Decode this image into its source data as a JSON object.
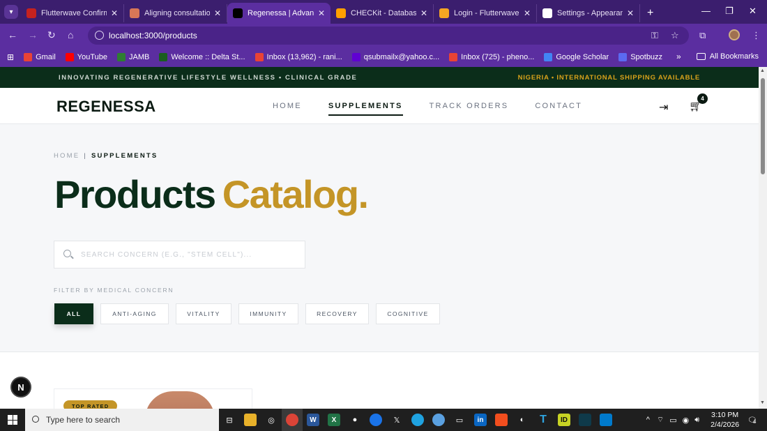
{
  "browser": {
    "tabs": [
      {
        "title": "Flutterwave Confirma",
        "icon": "gmail-icon",
        "color": "#c5221f",
        "active": false
      },
      {
        "title": "Aligning consultation",
        "icon": "claude-icon",
        "color": "#d97757",
        "active": false
      },
      {
        "title": "Regenessa | Advance",
        "icon": "vercel-icon",
        "color": "#000000",
        "active": true
      },
      {
        "title": "CHECKit - Database",
        "icon": "firebase-icon",
        "color": "#ffa000",
        "active": false
      },
      {
        "title": "Login - Flutterwave",
        "icon": "flutterwave-icon",
        "color": "#f5a623",
        "active": false
      },
      {
        "title": "Settings - Appearanc",
        "icon": "gear-icon",
        "color": "#ffffff",
        "active": false
      }
    ],
    "url": "localhost:3000/products",
    "bookmarks": [
      {
        "label": "Gmail",
        "color": "#ea4335"
      },
      {
        "label": "YouTube",
        "color": "#ff0000"
      },
      {
        "label": "JAMB",
        "color": "#2e7d32"
      },
      {
        "label": "Welcome :: Delta St...",
        "color": "#1b5e20"
      },
      {
        "label": "Inbox (13,962) - rani...",
        "color": "#ea4335"
      },
      {
        "label": "qsubmailx@yahoo.c...",
        "color": "#6001d2"
      },
      {
        "label": "Inbox (725) - pheno...",
        "color": "#ea4335"
      },
      {
        "label": "Google Scholar",
        "color": "#4285f4"
      },
      {
        "label": "Spotbuzz",
        "color": "#5b6af0"
      }
    ],
    "all_bookmarks": "All Bookmarks"
  },
  "site": {
    "promo_left": "INNOVATING REGENERATIVE LIFESTYLE WELLNESS • CLINICAL GRADE",
    "promo_right": "NIGERIA • INTERNATIONAL SHIPPING AVAILABLE",
    "logo": "REGENESSA",
    "nav": [
      "HOME",
      "SUPPLEMENTS",
      "TRACK ORDERS",
      "CONTACT"
    ],
    "nav_active": "SUPPLEMENTS",
    "cart_count": "4",
    "breadcrumb": {
      "home": "HOME",
      "sep": "|",
      "current": "SUPPLEMENTS"
    },
    "heading_a": "Products",
    "heading_b": "Catalog.",
    "search_placeholder": "SEARCH CONCERN (E.G., \"STEM CELL\")...",
    "filter_label": "FILTER BY MEDICAL CONCERN",
    "filters": [
      {
        "label": "ALL",
        "active": true
      },
      {
        "label": "ANTI-AGING",
        "active": false
      },
      {
        "label": "VITALITY",
        "active": false
      },
      {
        "label": "IMMUNITY",
        "active": false
      },
      {
        "label": "RECOVERY",
        "active": false
      },
      {
        "label": "COGNITIVE",
        "active": false
      }
    ],
    "card_badge": "TOP RATED",
    "next_badge": "N"
  },
  "taskbar": {
    "search_placeholder": "Type here to search",
    "time": "3:10 PM",
    "date": "2/4/2026",
    "notifications": "4"
  },
  "colors": {
    "browser_frame": "#5b2ea0",
    "brand_dark": "#0b2d1a",
    "brand_gold": "#c49527"
  }
}
